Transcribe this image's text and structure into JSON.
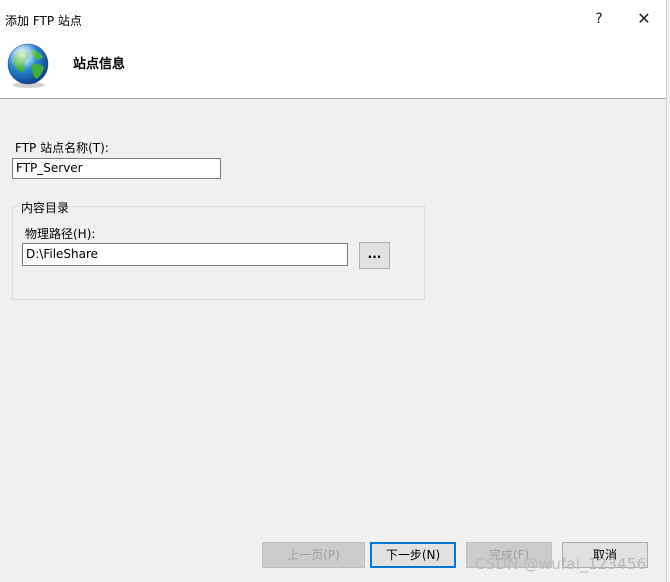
{
  "window": {
    "title": "添加 FTP 站点",
    "help_glyph": "?",
    "close_glyph": "✕"
  },
  "header": {
    "title": "站点信息",
    "icon": "globe-icon"
  },
  "form": {
    "site_name_label": "FTP 站点名称(T):",
    "site_name_value": "FTP_Server",
    "content_dir_legend": "内容目录",
    "physical_path_label": "物理路径(H):",
    "physical_path_value": "D:\\FileShare",
    "browse_label": "..."
  },
  "footer": {
    "prev_label": "上一页(P)",
    "next_label": "下一步(N)",
    "finish_label": "完成(F)",
    "cancel_label": "取消"
  },
  "watermark": "CSDN @wufai_123456",
  "colors": {
    "accent": "#0078d7",
    "dialog_bg": "#f0f0f0",
    "header_bg": "#ffffff"
  }
}
